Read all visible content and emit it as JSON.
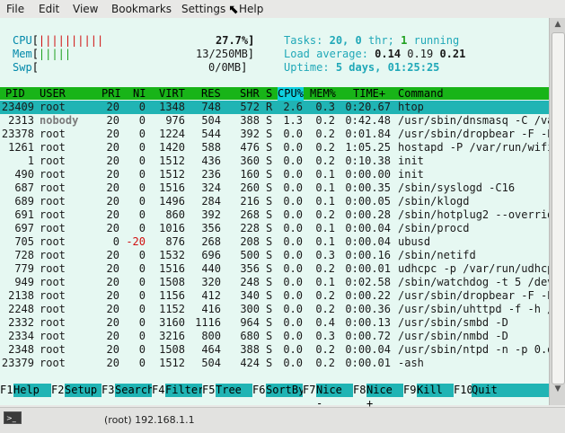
{
  "menubar": {
    "items": [
      "File",
      "Edit",
      "View",
      "Bookmarks",
      "Settings",
      "Help"
    ]
  },
  "meters": {
    "cpu": {
      "label": "CPU",
      "bars": "||||||||||",
      "value": "27.7%"
    },
    "mem": {
      "label": "Mem",
      "bars": "|||||",
      "value": "13/250MB"
    },
    "swp": {
      "label": "Swp",
      "bars": "",
      "value": "0/0MB"
    }
  },
  "summary": {
    "tasks_label": "Tasks:",
    "tasks": "20,",
    "thr": "0",
    "thr_label": "thr;",
    "running": "1",
    "running_label": "running",
    "load_label": "Load average:",
    "load1": "0.14",
    "load5": "0.19",
    "load15": "0.21",
    "uptime_label": "Uptime:",
    "uptime": "5 days, 01:25:25"
  },
  "columns": [
    "PID",
    "USER",
    "PRI",
    "NI",
    "VIRT",
    "RES",
    "SHR",
    "S",
    "CPU%",
    "MEM%",
    "TIME+",
    "Command"
  ],
  "processes": [
    {
      "pid": "23409",
      "user": "root",
      "pri": "20",
      "ni": "0",
      "virt": "1348",
      "res": "748",
      "shr": "572",
      "s": "R",
      "cpu": "2.6",
      "mem": "0.3",
      "time": "0:20.67",
      "cmd": "htop"
    },
    {
      "pid": "2313",
      "user": "nobody",
      "pri": "20",
      "ni": "0",
      "virt": "976",
      "res": "504",
      "shr": "388",
      "s": "S",
      "cpu": "1.3",
      "mem": "0.2",
      "time": "0:42.48",
      "cmd": "/usr/sbin/dnsmasq -C /va"
    },
    {
      "pid": "23378",
      "user": "root",
      "pri": "20",
      "ni": "0",
      "virt": "1224",
      "res": "544",
      "shr": "392",
      "s": "S",
      "cpu": "0.0",
      "mem": "0.2",
      "time": "0:01.84",
      "cmd": "/usr/sbin/dropbear -F -P"
    },
    {
      "pid": "1261",
      "user": "root",
      "pri": "20",
      "ni": "0",
      "virt": "1420",
      "res": "588",
      "shr": "476",
      "s": "S",
      "cpu": "0.0",
      "mem": "0.2",
      "time": "1:05.25",
      "cmd": "hostapd -P /var/run/wifi"
    },
    {
      "pid": "1",
      "user": "root",
      "pri": "20",
      "ni": "0",
      "virt": "1512",
      "res": "436",
      "shr": "360",
      "s": "S",
      "cpu": "0.0",
      "mem": "0.2",
      "time": "0:10.38",
      "cmd": "init"
    },
    {
      "pid": "490",
      "user": "root",
      "pri": "20",
      "ni": "0",
      "virt": "1512",
      "res": "236",
      "shr": "160",
      "s": "S",
      "cpu": "0.0",
      "mem": "0.1",
      "time": "0:00.00",
      "cmd": "init"
    },
    {
      "pid": "687",
      "user": "root",
      "pri": "20",
      "ni": "0",
      "virt": "1516",
      "res": "324",
      "shr": "260",
      "s": "S",
      "cpu": "0.0",
      "mem": "0.1",
      "time": "0:00.35",
      "cmd": "/sbin/syslogd -C16"
    },
    {
      "pid": "689",
      "user": "root",
      "pri": "20",
      "ni": "0",
      "virt": "1496",
      "res": "284",
      "shr": "216",
      "s": "S",
      "cpu": "0.0",
      "mem": "0.1",
      "time": "0:00.05",
      "cmd": "/sbin/klogd"
    },
    {
      "pid": "691",
      "user": "root",
      "pri": "20",
      "ni": "0",
      "virt": "860",
      "res": "392",
      "shr": "268",
      "s": "S",
      "cpu": "0.0",
      "mem": "0.2",
      "time": "0:00.28",
      "cmd": "/sbin/hotplug2 --overrid"
    },
    {
      "pid": "697",
      "user": "root",
      "pri": "20",
      "ni": "0",
      "virt": "1016",
      "res": "356",
      "shr": "228",
      "s": "S",
      "cpu": "0.0",
      "mem": "0.1",
      "time": "0:00.04",
      "cmd": "/sbin/procd"
    },
    {
      "pid": "705",
      "user": "root",
      "pri": "0",
      "ni": "-20",
      "virt": "876",
      "res": "268",
      "shr": "208",
      "s": "S",
      "cpu": "0.0",
      "mem": "0.1",
      "time": "0:00.04",
      "cmd": "ubusd"
    },
    {
      "pid": "728",
      "user": "root",
      "pri": "20",
      "ni": "0",
      "virt": "1532",
      "res": "696",
      "shr": "500",
      "s": "S",
      "cpu": "0.0",
      "mem": "0.3",
      "time": "0:00.16",
      "cmd": "/sbin/netifd"
    },
    {
      "pid": "779",
      "user": "root",
      "pri": "20",
      "ni": "0",
      "virt": "1516",
      "res": "440",
      "shr": "356",
      "s": "S",
      "cpu": "0.0",
      "mem": "0.2",
      "time": "0:00.01",
      "cmd": "udhcpc -p /var/run/udhcp"
    },
    {
      "pid": "949",
      "user": "root",
      "pri": "20",
      "ni": "0",
      "virt": "1508",
      "res": "320",
      "shr": "248",
      "s": "S",
      "cpu": "0.0",
      "mem": "0.1",
      "time": "0:02.58",
      "cmd": "/sbin/watchdog -t 5 /dev"
    },
    {
      "pid": "2138",
      "user": "root",
      "pri": "20",
      "ni": "0",
      "virt": "1156",
      "res": "412",
      "shr": "340",
      "s": "S",
      "cpu": "0.0",
      "mem": "0.2",
      "time": "0:00.22",
      "cmd": "/usr/sbin/dropbear -F -P"
    },
    {
      "pid": "2248",
      "user": "root",
      "pri": "20",
      "ni": "0",
      "virt": "1152",
      "res": "416",
      "shr": "300",
      "s": "S",
      "cpu": "0.0",
      "mem": "0.2",
      "time": "0:00.36",
      "cmd": "/usr/sbin/uhttpd -f -h /"
    },
    {
      "pid": "2332",
      "user": "root",
      "pri": "20",
      "ni": "0",
      "virt": "3160",
      "res": "1116",
      "shr": "964",
      "s": "S",
      "cpu": "0.0",
      "mem": "0.4",
      "time": "0:00.13",
      "cmd": "/usr/sbin/smbd -D"
    },
    {
      "pid": "2334",
      "user": "root",
      "pri": "20",
      "ni": "0",
      "virt": "3216",
      "res": "800",
      "shr": "680",
      "s": "S",
      "cpu": "0.0",
      "mem": "0.3",
      "time": "0:00.72",
      "cmd": "/usr/sbin/nmbd -D"
    },
    {
      "pid": "2348",
      "user": "root",
      "pri": "20",
      "ni": "0",
      "virt": "1508",
      "res": "464",
      "shr": "388",
      "s": "S",
      "cpu": "0.0",
      "mem": "0.2",
      "time": "0:00.04",
      "cmd": "/usr/sbin/ntpd -n -p 0.o"
    },
    {
      "pid": "23379",
      "user": "root",
      "pri": "20",
      "ni": "0",
      "virt": "1512",
      "res": "504",
      "shr": "424",
      "s": "S",
      "cpu": "0.0",
      "mem": "0.2",
      "time": "0:00.01",
      "cmd": "-ash"
    }
  ],
  "fkeys": [
    {
      "key": "F1",
      "label": "Help"
    },
    {
      "key": "F2",
      "label": "Setup"
    },
    {
      "key": "F3",
      "label": "Search"
    },
    {
      "key": "F4",
      "label": "Filter"
    },
    {
      "key": "F5",
      "label": "Tree"
    },
    {
      "key": "F6",
      "label": "SortBy"
    },
    {
      "key": "F7",
      "label": "Nice -"
    },
    {
      "key": "F8",
      "label": "Nice +"
    },
    {
      "key": "F9",
      "label": "Kill"
    },
    {
      "key": "F10",
      "label": "Quit"
    }
  ],
  "taskbar": {
    "title": "(root) 192.168.1.1",
    "icon": "terminal-icon"
  },
  "colors": {
    "header_bg": "#18b418",
    "selected_bg": "#20b4b4",
    "sorted_col_bg": "#10d0e0",
    "terminal_bg": "#e6f8f2",
    "nice_negative": "#d01010"
  }
}
